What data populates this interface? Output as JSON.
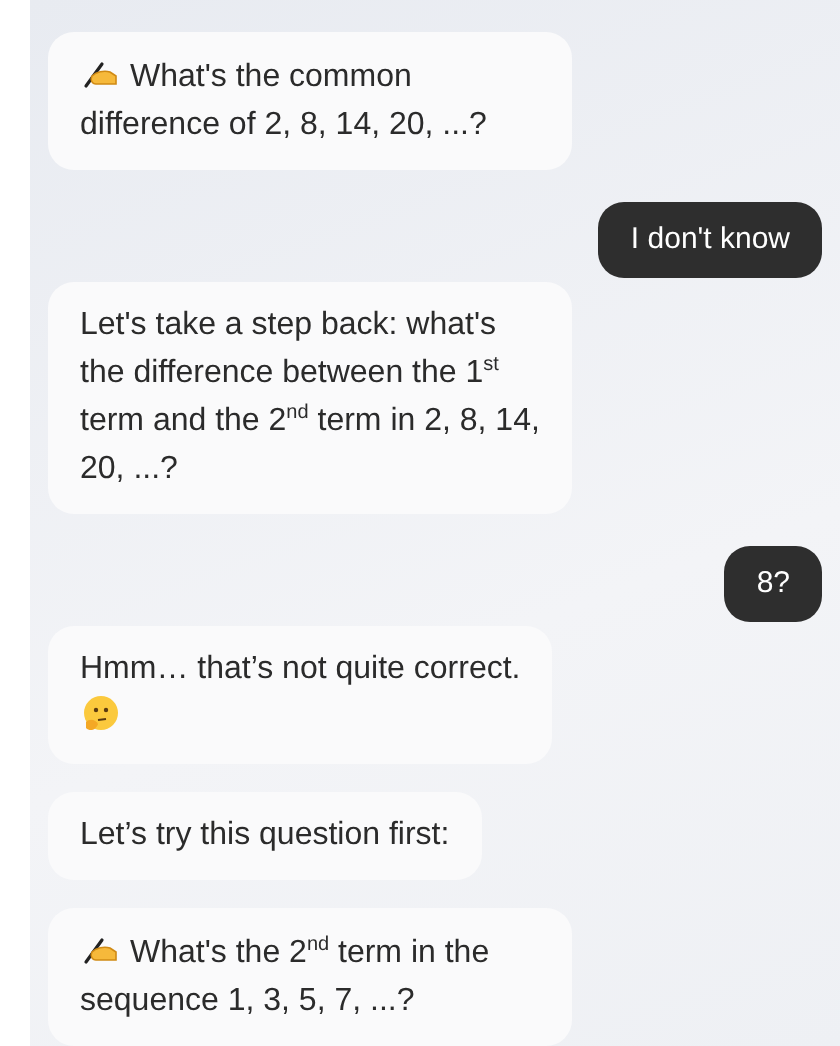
{
  "messages": [
    {
      "kind": "bot-task",
      "text": "What's the common difference of 2, 8, 14, 20, ...?"
    },
    {
      "kind": "user",
      "text": "I don't know"
    },
    {
      "kind": "bot",
      "text": "Let's take a step back: what's the difference between the 1$^{st}$ term and the 2$^{nd}$ term in 2, 8, 14, 20, ...?"
    },
    {
      "kind": "user",
      "text": "8?"
    },
    {
      "kind": "bot-thinking",
      "text": "Hmm… that’s not quite correct."
    },
    {
      "kind": "bot",
      "text": "Let’s try this question first:"
    },
    {
      "kind": "bot-task",
      "text": "What's the 2$^{nd}$ term in the sequence 1, 3, 5, 7, ...?"
    }
  ]
}
